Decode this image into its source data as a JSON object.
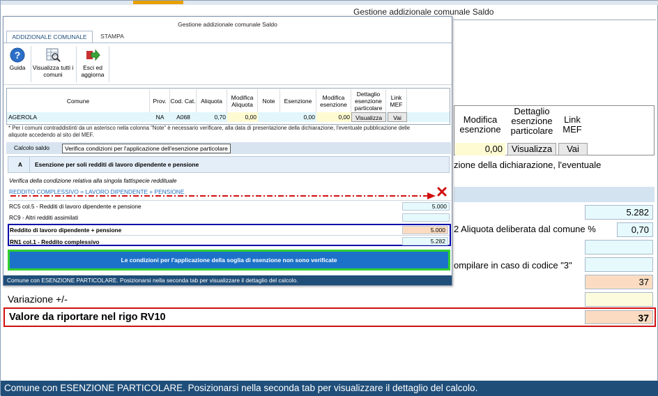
{
  "background": {
    "window_title": "Gestione addizionale comunale Saldo",
    "table_headers": [
      "Modifica esenzione",
      "Dettaglio esenzione particolare",
      "Link MEF"
    ],
    "row_values": {
      "modifica": "0,00",
      "visualizza": "Visualizza",
      "vai": "Vai"
    },
    "note_fragment": "zione della dichiarazione, l'eventuale",
    "fields": {
      "v1": "5.282",
      "aliquota_label": "2 Aliquota deliberata dal comune %",
      "aliquota_value": "0,70",
      "compilare_label": "ompilare in caso di codice \"3\"",
      "v_37": "37",
      "variazione_label": "Variazione +/-",
      "valore_label": "Valore da riportare nel rigo RV10",
      "valore_value": "37"
    },
    "status_bar": "Comune con ESENZIONE PARTICOLARE. Posizionarsi nella seconda tab per visualizzare il dettaglio del calcolo."
  },
  "dialog": {
    "title": "Gestione addizionale comunale Saldo",
    "tabs": [
      "ADDIZIONALE COMUNALE",
      "STAMPA"
    ],
    "ribbon": {
      "guida": "Guida",
      "visualizza": "Visualizza tutti i comuni",
      "esci": "Esci ed aggiorna"
    },
    "grid": {
      "headers": [
        "Comune",
        "Prov.",
        "Cod. Cat.",
        "Aliquota",
        "Modifica Aliquota",
        "Note",
        "Esenzione",
        "Modifica esenzione",
        "Dettaglio esenzione particolare",
        "Link MEF"
      ],
      "row": {
        "comune": "AGEROLA",
        "prov": "NA",
        "cod": "A068",
        "aliquota": "0,70",
        "mod_aliquota": "0,00",
        "note": "",
        "esenzione": "0,00",
        "mod_esenzione": "0,00",
        "dettaglio": "Visualizza",
        "link": "Vai"
      }
    },
    "note": "* Per i comuni contraddistinti da un asterisco nella colonna \"Note\" è necessario verificare, alla data di presentazione della dichiarazione, l'eventuale pubblicazione delle aliquote accedendo al sito del MEF.",
    "subtabs": [
      "Calcolo saldo",
      "Verifica condizioni per l'applicazione dell'esenzione particolare"
    ],
    "section": {
      "letter": "A",
      "title": "Esenzione per soli redditi di lavoro dipendente e pensione"
    },
    "verifica_text": "Verifica della condizione relativa alla singola fattispecie reddituale",
    "formula": "REDDITO COMPLESSIVO = LAVORO DIPENDENTE + PENSIONE",
    "rows": [
      {
        "label": "RC5 col.5 - Redditi di lavoro dipendente e pensione",
        "value": "5.000"
      },
      {
        "label": "RC9 - Altri redditi assimilati",
        "value": ""
      },
      {
        "label": "Reddito di lavoro dipendente + pensione",
        "value": "5.000"
      },
      {
        "label": "RN1 col.1 - Reddito complessivo",
        "value": "5.282"
      }
    ],
    "result": "Le condizioni per l'applicazione della soglia di esenzione non sono verificate",
    "status_bar": "Comune con ESENZIONE PARTICOLARE. Posizionarsi nella seconda tab per visualizzare il dettaglio del calcolo."
  },
  "colors": {
    "accent_blue": "#1f4e79",
    "button_blue": "#1c72c8",
    "red_mark": "#d01010",
    "green_border": "#30d030"
  },
  "icons": [
    "help-icon",
    "view-all-icon",
    "exit-update-icon",
    "red-x-icon"
  ]
}
